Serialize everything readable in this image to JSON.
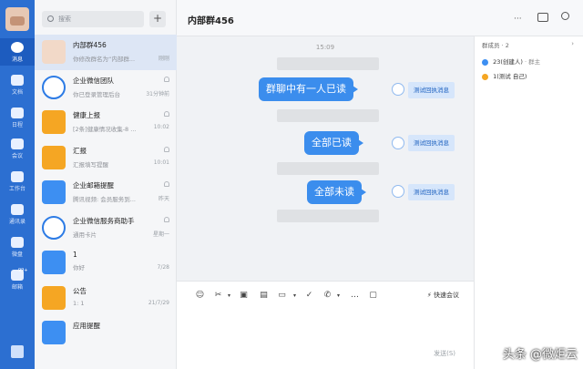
{
  "rail": {
    "items": [
      {
        "label": "消息",
        "icon": "chat-icon",
        "active": true
      },
      {
        "label": "文档",
        "icon": "document-icon"
      },
      {
        "label": "日程",
        "icon": "calendar-icon"
      },
      {
        "label": "会议",
        "icon": "meeting-icon"
      },
      {
        "label": "工作台",
        "icon": "workbench-icon"
      },
      {
        "label": "通讯录",
        "icon": "contacts-icon"
      },
      {
        "label": "微盘",
        "icon": "drive-icon"
      },
      {
        "label": "邮箱",
        "icon": "mail-icon"
      }
    ],
    "mail_badge": "99+"
  },
  "conversations": {
    "search_placeholder": "搜索",
    "plus_label": "+",
    "items": [
      {
        "name": "内部群456",
        "preview": "你修改群名为“内部群...",
        "time": "刚刚",
        "color": "#f2d9c8",
        "active": true
      },
      {
        "name": "企业微信团队",
        "preview": "你已登录管理后台",
        "time": "31分钟前",
        "color": "#ffffff",
        "border": "#2c7be5"
      },
      {
        "name": "健康上报",
        "preview": "[2条]健康情况收集-8 ...",
        "time": "10:02",
        "color": "#f5a623"
      },
      {
        "name": "汇报",
        "preview": "汇报填写提醒",
        "time": "10:01",
        "color": "#f5a623"
      },
      {
        "name": "企业邮箱提醒",
        "preview": "腾讯视频: 会员服务到...",
        "time": "昨天",
        "color": "#3d8ff2"
      },
      {
        "name": "企业微信服务商助手",
        "preview": "通用卡片",
        "time": "星期一",
        "color": "#ffffff",
        "border": "#2c7be5"
      },
      {
        "name": "1",
        "preview": "你好",
        "time": "7/28",
        "color": "#3d8ff2"
      },
      {
        "name": "公告",
        "preview": "1: 1",
        "time": "21/7/29",
        "color": "#f5a623"
      },
      {
        "name": "应用提醒",
        "preview": "",
        "time": "",
        "color": "#3d8ff2"
      }
    ]
  },
  "chat": {
    "title": "内部群456",
    "more_label": "···",
    "time_separator": "15:09",
    "messages": [
      {
        "text": "群聊中有一人已读",
        "receipt": "测试回执消息"
      },
      {
        "text": "全部已读",
        "receipt": "测试回执消息"
      },
      {
        "text": "全部未读",
        "receipt": "测试回执消息"
      }
    ],
    "compose": {
      "quick_meeting": "快速会议",
      "send_label": "发送(S)"
    }
  },
  "members": {
    "title": "群成员",
    "count": "· 2",
    "list": [
      {
        "name": "23(创建人)",
        "tag": "· 群主"
      },
      {
        "name": "1(测试 自己)",
        "tag": ""
      }
    ]
  },
  "watermark": "头条 @微炬云",
  "colors": {
    "accent": "#3b8ded",
    "rail": "#2c6fd1"
  }
}
